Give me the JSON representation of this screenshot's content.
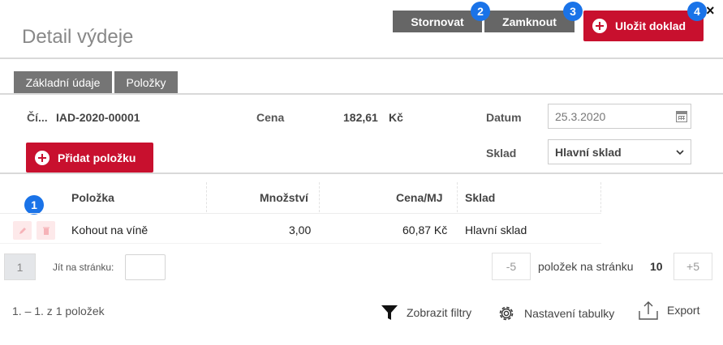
{
  "header": {
    "title": "Detail výdeje",
    "cancel_label": "Stornovat",
    "lock_label": "Zamknout",
    "save_label": "Uložit doklad",
    "close_glyph": "×"
  },
  "badges": [
    "1",
    "2",
    "3",
    "4"
  ],
  "tabs": [
    {
      "label": "Základní údaje"
    },
    {
      "label": "Položky"
    }
  ],
  "form": {
    "number_label": "Čí...",
    "number_value": "IAD-2020-00001",
    "price_label": "Cena",
    "price_value": "182,61",
    "price_currency": "Kč",
    "date_label": "Datum",
    "date_value": "25.3.2020",
    "warehouse_label": "Sklad",
    "warehouse_value": "Hlavní sklad",
    "add_item_label": "Přidat položku"
  },
  "table": {
    "columns": [
      "Položka",
      "Množství",
      "Cena/MJ",
      "Sklad"
    ],
    "rows": [
      {
        "item": "Kohout na víně",
        "quantity": "3,00",
        "unit_price": "60,87 Kč",
        "warehouse": "Hlavní sklad"
      }
    ]
  },
  "pagination": {
    "current_page": "1",
    "goto_label": "Jít na stránku:",
    "goto_value": "",
    "minus_label": "-5",
    "per_page_label": "položek na stránku",
    "per_page_value": "10",
    "plus_label": "+5",
    "summary": "1. – 1. z 1 položek"
  },
  "footer": {
    "filters_label": "Zobrazit filtry",
    "settings_label": "Nastavení tabulky",
    "export_label": "Export"
  },
  "icons": {
    "add": "plus-circle-icon",
    "calendar": "calendar-icon",
    "dropdown": "chevron-down-icon",
    "edit": "pencil-icon",
    "delete": "trash-icon",
    "filter": "funnel-icon",
    "settings": "gear-icon",
    "export": "upload-icon",
    "close": "close-icon"
  },
  "colors": {
    "accent_red": "#c8102e",
    "button_grey": "#666666",
    "tab_grey": "#757575",
    "badge_blue": "#1a73e8"
  }
}
